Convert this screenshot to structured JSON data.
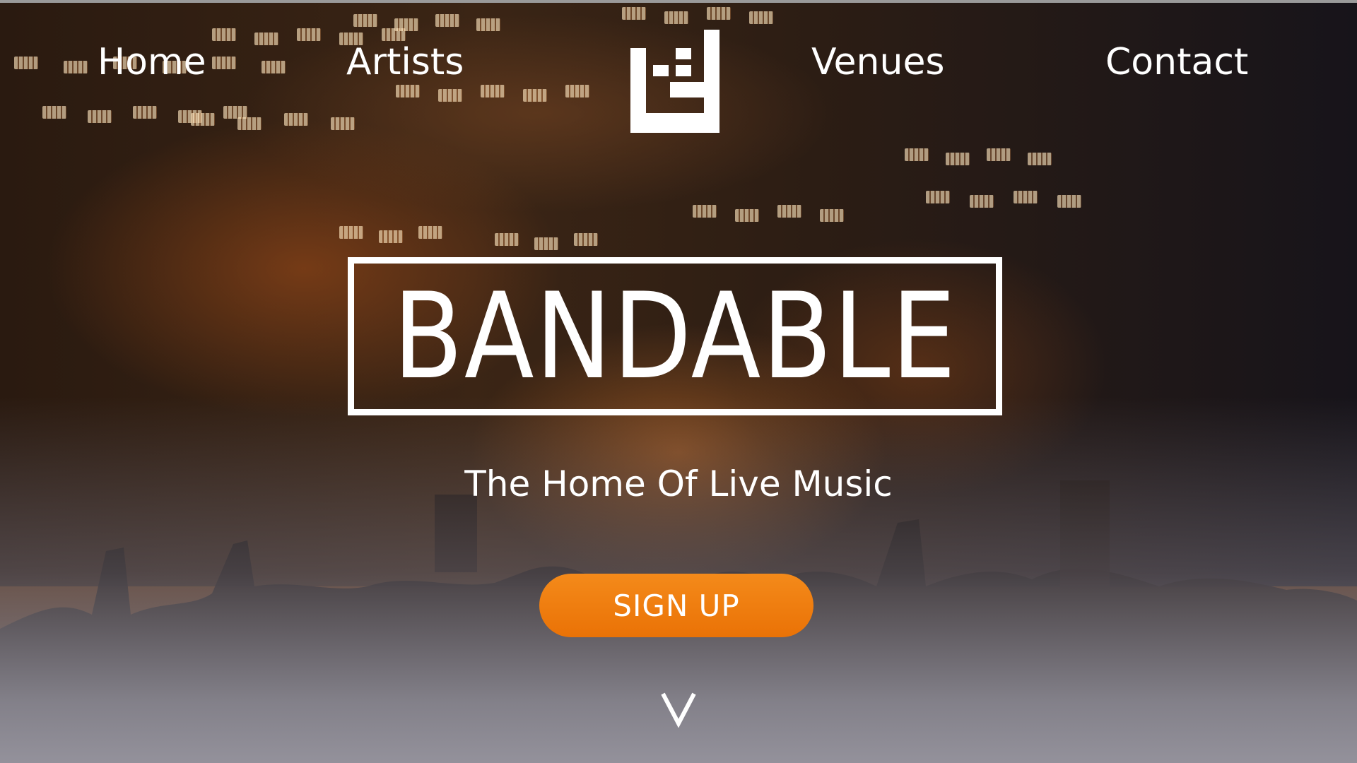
{
  "nav": {
    "items": [
      {
        "label": "Home"
      },
      {
        "label": "Artists"
      },
      {
        "label": "Venues"
      },
      {
        "label": "Contact"
      }
    ],
    "logo_icon": "bandable-logo-icon"
  },
  "hero": {
    "title": "BANDABLE",
    "tagline": "The Home Of Live Music",
    "cta_label": "SIGN UP",
    "scroll_icon": "chevron-down-icon",
    "background": "concert-crowd-photo"
  },
  "colors": {
    "accent": "#ED7A0C",
    "text": "#FFFFFF"
  }
}
